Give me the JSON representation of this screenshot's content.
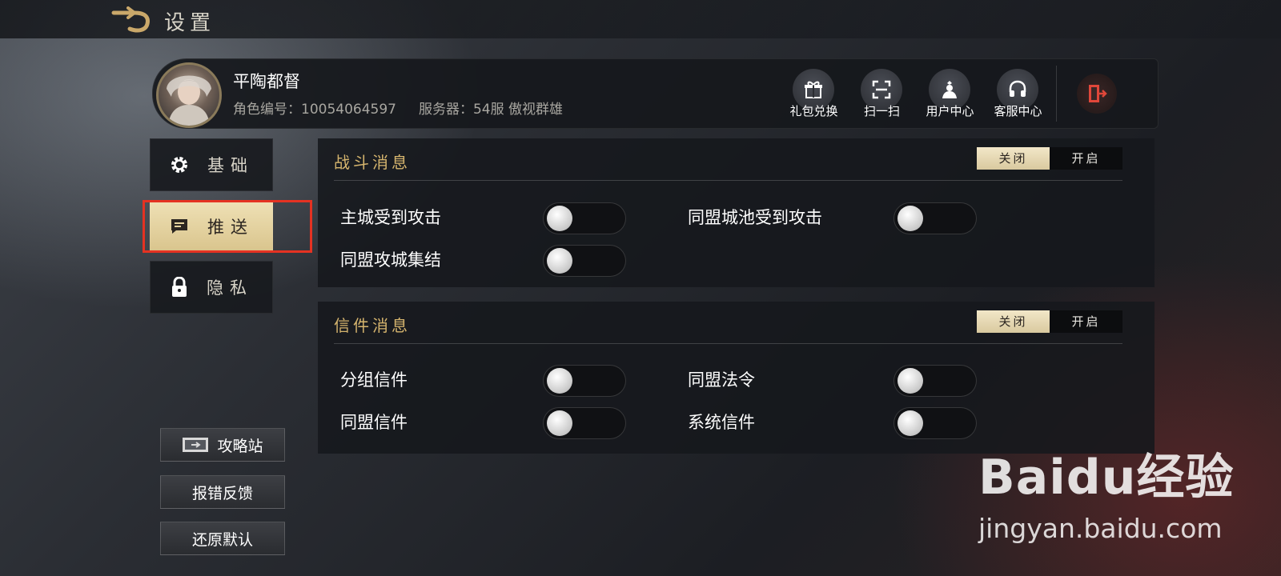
{
  "header": {
    "title": "设置",
    "back_icon": "back-arrow-icon"
  },
  "profile": {
    "name": "平陶都督",
    "role_id_label": "角色编号：",
    "role_id": "10054064597",
    "server_label": "服务器：",
    "server": "54服 傲视群雄",
    "actions": [
      {
        "label": "礼包兑换",
        "icon": "gift-icon"
      },
      {
        "label": "扫一扫",
        "icon": "scan-icon"
      },
      {
        "label": "用户中心",
        "icon": "user-icon"
      },
      {
        "label": "客服中心",
        "icon": "headset-icon"
      }
    ],
    "logout_icon": "logout-icon"
  },
  "nav": {
    "items": [
      {
        "label": "基础",
        "icon": "gear-icon",
        "active": false
      },
      {
        "label": "推送",
        "icon": "message-icon",
        "active": true
      },
      {
        "label": "隐私",
        "icon": "lock-icon",
        "active": false
      }
    ]
  },
  "panels": [
    {
      "title": "战斗消息",
      "segment": {
        "off_label": "关闭",
        "on_label": "开启",
        "selected": "关闭"
      },
      "options": [
        {
          "label": "主城受到攻击",
          "enabled": false
        },
        {
          "label": "同盟城池受到攻击",
          "enabled": false
        },
        {
          "label": "同盟攻城集结",
          "enabled": false
        }
      ]
    },
    {
      "title": "信件消息",
      "segment": {
        "off_label": "关闭",
        "on_label": "开启",
        "selected": "关闭"
      },
      "options": [
        {
          "label": "分组信件",
          "enabled": false
        },
        {
          "label": "同盟法令",
          "enabled": false
        },
        {
          "label": "同盟信件",
          "enabled": false
        },
        {
          "label": "系统信件",
          "enabled": false
        }
      ]
    }
  ],
  "sidebar_buttons": {
    "guide": "攻略站",
    "report": "报错反馈",
    "reset": "还原默认"
  },
  "watermark": {
    "brand": "Baidu经验",
    "url": "jingyan.baidu.com"
  },
  "colors": {
    "accent_gold": "#d6b56e",
    "active_tab": "#e6d49f",
    "highlight_red": "#e53222"
  }
}
